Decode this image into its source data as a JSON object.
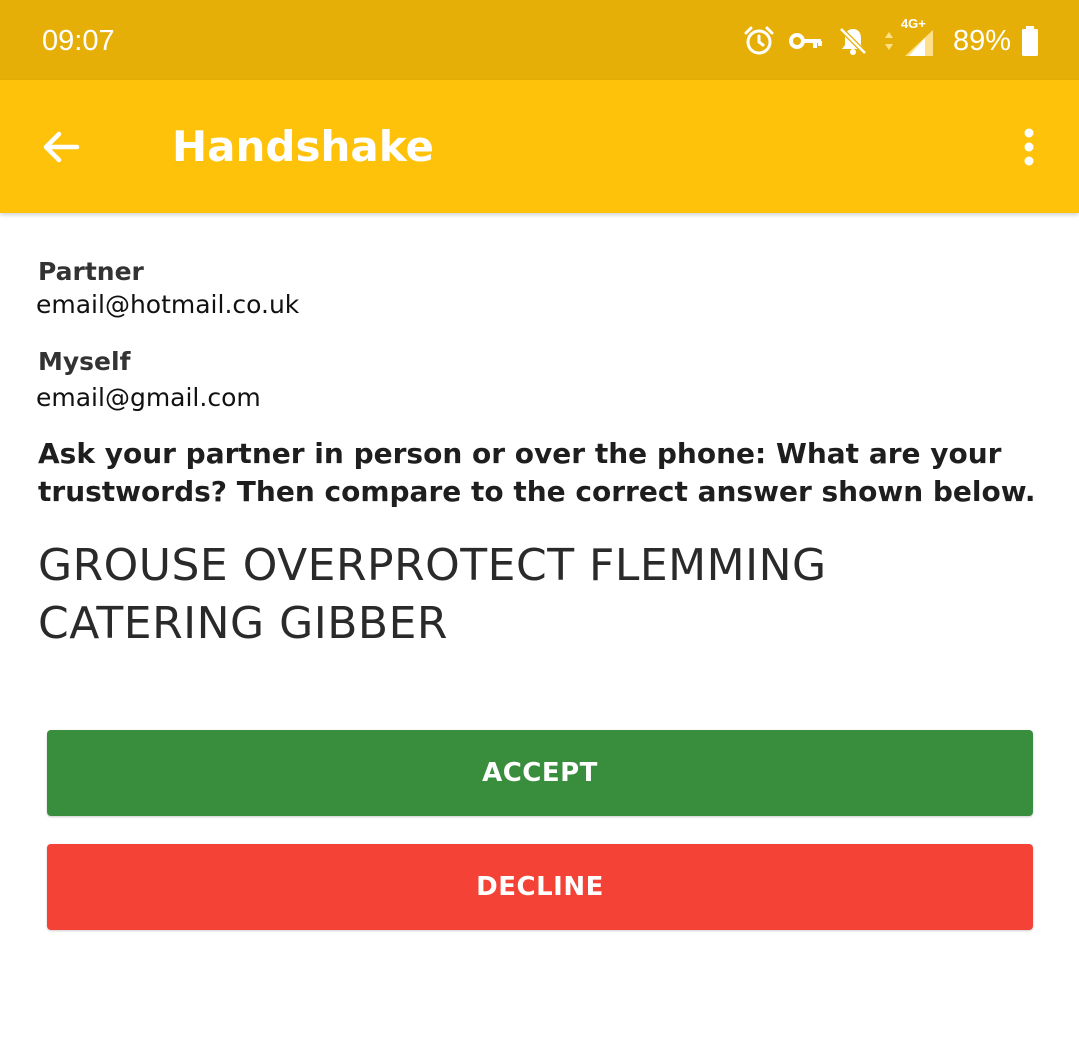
{
  "status_bar": {
    "time": "09:07",
    "network": "4G+",
    "battery": "89%",
    "icons": [
      "alarm-icon",
      "vpn-key-icon",
      "notifications-off-icon",
      "data-arrows-icon",
      "signal-icon",
      "battery-icon"
    ]
  },
  "app_bar": {
    "title": "Handshake",
    "back_icon": "arrow-back-icon",
    "menu_icon": "more-vert-icon"
  },
  "partner": {
    "label": "Partner",
    "email": "email@hotmail.co.uk"
  },
  "myself": {
    "label": "Myself",
    "email": "email@gmail.com"
  },
  "instructions": "Ask your partner in person or over the phone: What are your trustwords? Then compare to the correct answer shown below.",
  "trustwords": "GROUSE OVERPROTECT FLEMMING CATERING GIBBER",
  "buttons": {
    "accept": "ACCEPT",
    "decline": "DECLINE"
  },
  "colors": {
    "status_bar": "#e6af08",
    "app_bar": "#fec20b",
    "accept": "#388e3c",
    "decline": "#f44336"
  }
}
